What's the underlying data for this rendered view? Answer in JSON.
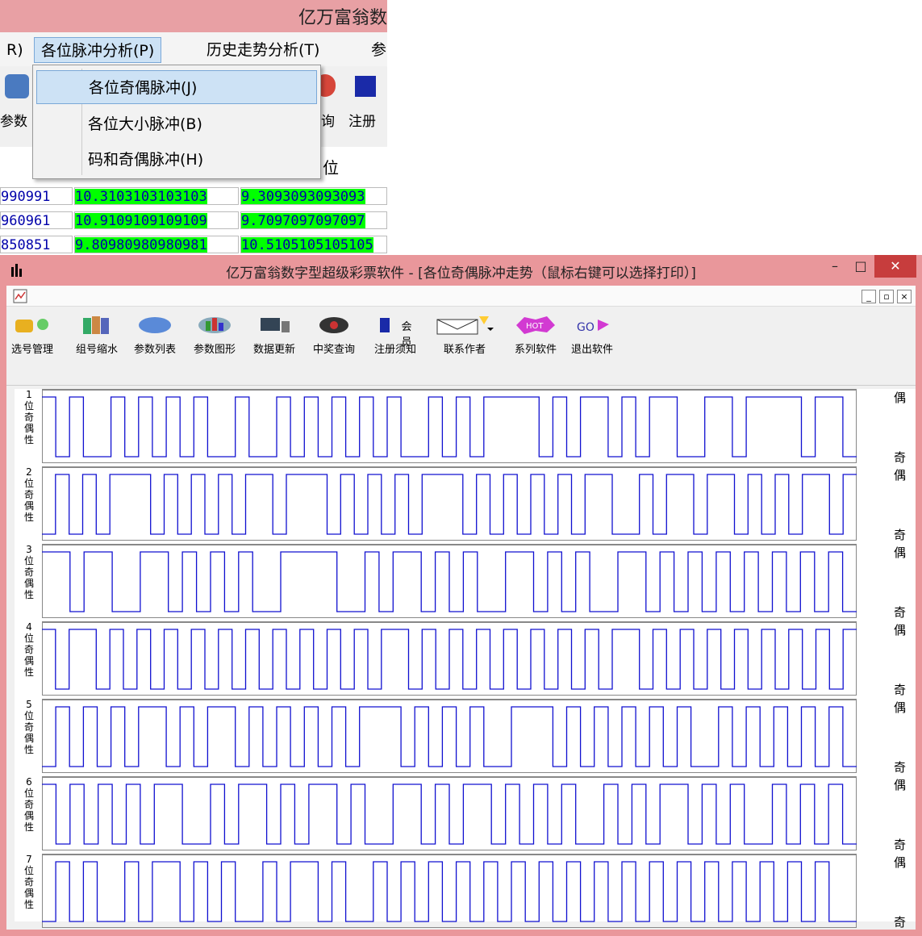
{
  "background_app": {
    "title_partial": "亿万富翁数",
    "menu": [
      "R)",
      "各位脉冲分析(P)",
      "历史走势分析(T)",
      "参"
    ],
    "dropdown": [
      "各位奇偶脉冲(J)",
      "各位大小脉冲(B)",
      "码和奇偶脉冲(H)"
    ],
    "toolbar_fragments": [
      "参数",
      "询",
      "注册"
    ],
    "column_header": "位",
    "rows": [
      [
        "990991",
        "10.3103103103103",
        "9.3093093093093"
      ],
      [
        "960961",
        "10.9109109109109",
        "9.7097097097097"
      ],
      [
        "850851",
        "9.80980980980981",
        "10.5105105105105"
      ]
    ]
  },
  "window": {
    "title": "亿万富翁数字型超级彩票软件 - [各位奇偶脉冲走势（鼠标右键可以选择打印）]",
    "minimize": "–",
    "maximize": "□",
    "close": "✕"
  },
  "toolbar": {
    "items": [
      {
        "label": "选号管理",
        "icon": "ticket-icon"
      },
      {
        "label": "组号缩水",
        "icon": "books-icon"
      },
      {
        "label": "参数列表",
        "icon": "list-icon"
      },
      {
        "label": "参数图形",
        "icon": "chart-icon"
      },
      {
        "label": "数据更新",
        "icon": "computer-icon"
      },
      {
        "label": "中奖查询",
        "icon": "eye-icon"
      },
      {
        "label": "注册须知",
        "icon": "register-icon"
      },
      {
        "label": "联系作者",
        "icon": "envelope-icon"
      },
      {
        "label": "系列软件",
        "icon": "hot-icon"
      },
      {
        "label": "退出软件",
        "icon": "exit-icon"
      }
    ],
    "member_label": "会员"
  },
  "panels": [
    {
      "index": "1",
      "label": "位奇偶性",
      "top": "偶",
      "bottom": "奇",
      "bits": [
        1,
        0,
        1,
        0,
        0,
        1,
        0,
        1,
        0,
        1,
        0,
        1,
        0,
        0,
        1,
        0,
        0,
        1,
        0,
        1,
        0,
        1,
        0,
        1,
        0,
        1,
        0,
        0,
        1,
        0,
        1,
        0,
        1,
        1,
        1,
        1,
        0,
        1,
        0,
        1,
        1,
        0,
        1,
        0,
        1,
        1,
        0,
        0,
        1,
        1,
        0,
        1,
        1,
        1,
        1,
        0,
        1,
        1,
        0
      ]
    },
    {
      "index": "2",
      "label": "位奇偶性",
      "top": "偶",
      "bottom": "奇",
      "bits": [
        0,
        1,
        0,
        1,
        0,
        1,
        1,
        1,
        0,
        1,
        0,
        1,
        0,
        1,
        0,
        1,
        1,
        0,
        1,
        1,
        1,
        0,
        1,
        0,
        1,
        0,
        1,
        0,
        1,
        1,
        1,
        0,
        1,
        0,
        1,
        0,
        1,
        0,
        1,
        0,
        1,
        1,
        0,
        0,
        1,
        0,
        1,
        1,
        0,
        1,
        1,
        0,
        1,
        0,
        1,
        0,
        1,
        1,
        0,
        1
      ]
    },
    {
      "index": "3",
      "label": "位奇偶性",
      "top": "偶",
      "bottom": "奇",
      "bits": [
        1,
        1,
        0,
        1,
        1,
        0,
        0,
        1,
        1,
        0,
        1,
        0,
        1,
        0,
        1,
        0,
        0,
        1,
        1,
        1,
        1,
        0,
        0,
        1,
        0,
        1,
        1,
        0,
        1,
        0,
        1,
        0,
        0,
        1,
        1,
        0,
        1,
        0,
        1,
        0,
        0,
        1,
        1,
        0,
        1,
        0,
        1,
        0,
        1,
        0,
        1,
        0,
        1,
        0,
        1,
        0,
        1,
        0
      ]
    },
    {
      "index": "4",
      "label": "位奇偶性",
      "top": "偶",
      "bottom": "奇",
      "bits": [
        1,
        0,
        1,
        1,
        0,
        1,
        0,
        1,
        0,
        1,
        0,
        1,
        0,
        1,
        0,
        1,
        0,
        1,
        0,
        1,
        0,
        1,
        0,
        1,
        0,
        1,
        1,
        0,
        1,
        0,
        1,
        0,
        1,
        0,
        1,
        0,
        1,
        0,
        1,
        0,
        1,
        0,
        1,
        1,
        0,
        1,
        0,
        1,
        0,
        1,
        0,
        1,
        0,
        1,
        0,
        1,
        0,
        1,
        0,
        1
      ]
    },
    {
      "index": "5",
      "label": "位奇偶性",
      "top": "偶",
      "bottom": "奇",
      "bits": [
        0,
        1,
        0,
        1,
        0,
        1,
        0,
        1,
        1,
        0,
        1,
        0,
        1,
        1,
        0,
        1,
        0,
        1,
        0,
        1,
        0,
        1,
        0,
        1,
        1,
        1,
        0,
        1,
        0,
        1,
        0,
        1,
        0,
        0,
        1,
        1,
        1,
        0,
        1,
        0,
        1,
        0,
        1,
        0,
        1,
        0,
        1,
        0,
        0,
        1,
        0,
        1,
        0,
        1,
        0,
        1,
        0,
        1,
        0
      ]
    },
    {
      "index": "6",
      "label": "位奇偶性",
      "top": "偶",
      "bottom": "奇",
      "bits": [
        1,
        0,
        1,
        0,
        1,
        0,
        1,
        0,
        1,
        1,
        0,
        0,
        1,
        0,
        1,
        1,
        0,
        1,
        0,
        1,
        1,
        0,
        1,
        0,
        0,
        1,
        1,
        0,
        1,
        0,
        1,
        1,
        0,
        1,
        0,
        1,
        0,
        1,
        0,
        0,
        1,
        0,
        1,
        0,
        1,
        1,
        0,
        1,
        0,
        1,
        0,
        0,
        1,
        0,
        1,
        0,
        1,
        0
      ]
    },
    {
      "index": "7",
      "label": "位奇偶性",
      "top": "偶",
      "bottom": "奇",
      "bits": [
        0,
        1,
        0,
        1,
        0,
        0,
        1,
        0,
        1,
        1,
        0,
        1,
        0,
        1,
        0,
        0,
        1,
        0,
        1,
        1,
        0,
        1,
        0,
        0,
        1,
        0,
        1,
        0,
        1,
        0,
        1,
        0,
        1,
        0,
        1,
        0,
        1,
        0,
        1,
        0,
        1,
        0,
        1,
        0,
        1,
        0,
        1,
        0,
        1,
        0,
        1,
        0,
        1,
        0,
        1,
        0,
        1,
        0,
        0
      ]
    }
  ]
}
